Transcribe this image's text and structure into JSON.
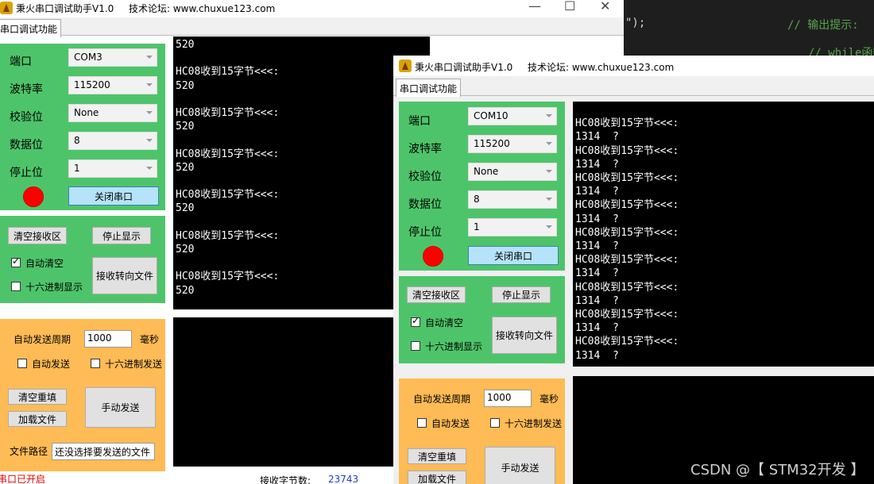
{
  "editor": {
    "line1_a": "\");",
    "line1_b": "// 输出提示:",
    "line2": "// while函数"
  },
  "back_window": {
    "title": "秉火串口调试助手V1.0",
    "forum": "技术论坛: www.chuxue123.com",
    "tab": "串口调试功能",
    "labels": {
      "port": "端口",
      "baud": "波特率",
      "parity": "校验位",
      "databits": "数据位",
      "stopbits": "停止位"
    },
    "values": {
      "port": "COM3",
      "baud": "115200",
      "parity": "None",
      "databits": "8",
      "stopbits": "1"
    },
    "close_port": "关闭串口",
    "clear_receive": "清空接收区",
    "stop_display": "停止显示",
    "auto_clear": "自动清空",
    "hex_display": "十六进制显示",
    "receive_to_file": "接收转向文件",
    "auto_send_period": "自动发送周期",
    "period_value": "1000",
    "ms": "毫秒",
    "auto_send": "自动发送",
    "hex_send": "十六进制发送",
    "clear_refill": "清空重填",
    "load_file": "加载文件",
    "manual_send": "手动发送",
    "file_path_label": "文件路径",
    "file_path_value": "还没选择要发送的文件",
    "status_open": "串口已开启",
    "rx_bytes_label": "接收字节数:",
    "rx_bytes_value": "23743",
    "terminal": "520\n\nHC08收到15字节<<<:\n520\n\nHC08收到15字节<<<:\n520\n\nHC08收到15字节<<<:\n520\n\nHC08收到15字节<<<:\n520\n\nHC08收到15字节<<<:\n520\n\nHC08收到15字节<<<:\n520"
  },
  "front_window": {
    "title": "秉火串口调试助手V1.0",
    "forum": "技术论坛: www.chuxue123.com",
    "tab": "串口调试功能",
    "labels": {
      "port": "端口",
      "baud": "波特率",
      "parity": "校验位",
      "databits": "数据位",
      "stopbits": "停止位"
    },
    "values": {
      "port": "COM10",
      "baud": "115200",
      "parity": "None",
      "databits": "8",
      "stopbits": "1"
    },
    "close_port": "关闭串口",
    "clear_receive": "清空接收区",
    "stop_display": "停止显示",
    "auto_clear": "自动清空",
    "hex_display": "十六进制显示",
    "receive_to_file": "接收转向文件",
    "auto_send_period": "自动发送周期",
    "period_value": "1000",
    "ms": "毫秒",
    "auto_send": "自动发送",
    "hex_send": "十六进制发送",
    "clear_refill": "清空重填",
    "load_file": "加载文件",
    "manual_send": "手动发送",
    "terminal": "\nHC08收到15字节<<<:\n1314  ?\nHC08收到15字节<<<:\n1314  ?\nHC08收到15字节<<<:\n1314  ?\nHC08收到15字节<<<:\n1314  ?\nHC08收到15字节<<<:\n1314  ?\nHC08收到15字节<<<:\n1314  ?\nHC08收到15字节<<<:\n1314  ?\nHC08收到15字节<<<:\n1314  ?\nHC08收到15字节<<<:\n1314  ?"
  },
  "watermark": "CSDN @【 STM32开发 】",
  "colors": {
    "green": "#4ec46a",
    "orange": "#ffbb55",
    "led": "#ff0000",
    "button_blue": "#b5e3f9"
  }
}
